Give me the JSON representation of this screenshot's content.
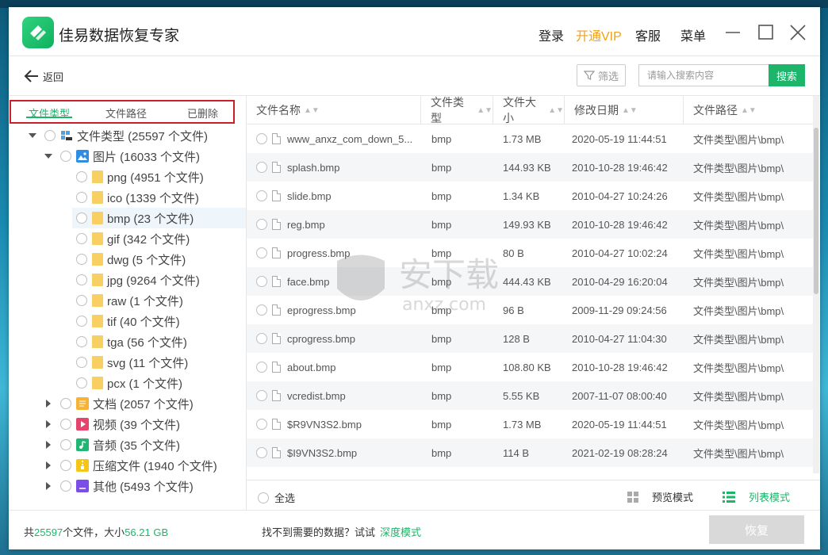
{
  "app": {
    "title": "佳易数据恢复专家",
    "logo_icon": "logo-icon",
    "accent": "#1db56a",
    "vip_color": "#f0a11a"
  },
  "titlebar": {
    "login": "登录",
    "vip": "开通VIP",
    "service": "客服",
    "menu": "菜单"
  },
  "toolbar": {
    "back": "返回",
    "filter": "筛选",
    "search_placeholder": "请输入搜索内容",
    "search_btn": "搜索"
  },
  "tabs": [
    {
      "label": "文件类型"
    },
    {
      "label": "文件路径"
    },
    {
      "label": "已删除"
    }
  ],
  "tree": [
    {
      "label": "文件类型 (25597 个文件)"
    },
    {
      "label": "图片 (16033 个文件)"
    },
    {
      "label": "png (4951 个文件)"
    },
    {
      "label": "ico (1339 个文件)"
    },
    {
      "label": "bmp (23 个文件)"
    },
    {
      "label": "gif (342 个文件)"
    },
    {
      "label": "dwg (5 个文件)"
    },
    {
      "label": "jpg (9264 个文件)"
    },
    {
      "label": "raw (1 个文件)"
    },
    {
      "label": "tif (40 个文件)"
    },
    {
      "label": "tga (56 个文件)"
    },
    {
      "label": "svg (11 个文件)"
    },
    {
      "label": "pcx (1 个文件)"
    },
    {
      "label": "文档 (2057 个文件)"
    },
    {
      "label": "视频 (39 个文件)"
    },
    {
      "label": "音频 (35 个文件)"
    },
    {
      "label": "压缩文件 (1940 个文件)"
    },
    {
      "label": "其他 (5493 个文件)"
    }
  ],
  "table": {
    "columns": [
      "文件名称",
      "文件类型",
      "文件大小",
      "修改日期",
      "文件路径"
    ],
    "rows": [
      {
        "name": "www_anxz_com_down_5...",
        "type": "bmp",
        "size": "1.73 MB",
        "date": "2020-05-19 11:44:51",
        "path": "文件类型\\图片\\bmp\\"
      },
      {
        "name": "splash.bmp",
        "type": "bmp",
        "size": "144.93 KB",
        "date": "2010-10-28 19:46:42",
        "path": "文件类型\\图片\\bmp\\"
      },
      {
        "name": "slide.bmp",
        "type": "bmp",
        "size": "1.34 KB",
        "date": "2010-04-27 10:24:26",
        "path": "文件类型\\图片\\bmp\\"
      },
      {
        "name": "reg.bmp",
        "type": "bmp",
        "size": "149.93 KB",
        "date": "2010-10-28 19:46:42",
        "path": "文件类型\\图片\\bmp\\"
      },
      {
        "name": "progress.bmp",
        "type": "bmp",
        "size": "80 B",
        "date": "2010-04-27 10:02:24",
        "path": "文件类型\\图片\\bmp\\"
      },
      {
        "name": "face.bmp",
        "type": "bmp",
        "size": "444.43 KB",
        "date": "2010-04-29 16:20:04",
        "path": "文件类型\\图片\\bmp\\"
      },
      {
        "name": "eprogress.bmp",
        "type": "bmp",
        "size": "96 B",
        "date": "2009-11-29 09:24:56",
        "path": "文件类型\\图片\\bmp\\"
      },
      {
        "name": "cprogress.bmp",
        "type": "bmp",
        "size": "128 B",
        "date": "2010-04-27 11:04:30",
        "path": "文件类型\\图片\\bmp\\"
      },
      {
        "name": "about.bmp",
        "type": "bmp",
        "size": "108.80 KB",
        "date": "2010-10-28 19:46:42",
        "path": "文件类型\\图片\\bmp\\"
      },
      {
        "name": "vcredist.bmp",
        "type": "bmp",
        "size": "5.55 KB",
        "date": "2007-11-07 08:00:40",
        "path": "文件类型\\图片\\bmp\\"
      },
      {
        "name": "$R9VN3S2.bmp",
        "type": "bmp",
        "size": "1.73 MB",
        "date": "2020-05-19 11:44:51",
        "path": "文件类型\\图片\\bmp\\"
      },
      {
        "name": "$I9VN3S2.bmp",
        "type": "bmp",
        "size": "114 B",
        "date": "2021-02-19 08:28:24",
        "path": "文件类型\\图片\\bmp\\"
      }
    ]
  },
  "footer": {
    "select_all": "全选",
    "preview_mode": "预览模式",
    "list_mode": "列表模式"
  },
  "status": {
    "prefix": "共",
    "count": "25597",
    "mid": "个文件，大小",
    "size": "56.21 GB",
    "hint": "找不到需要的数据？试试",
    "deep_mode": "深度模式",
    "recover": "恢复"
  },
  "watermark": {
    "text": "安下载",
    "sub": "anxz.com"
  }
}
